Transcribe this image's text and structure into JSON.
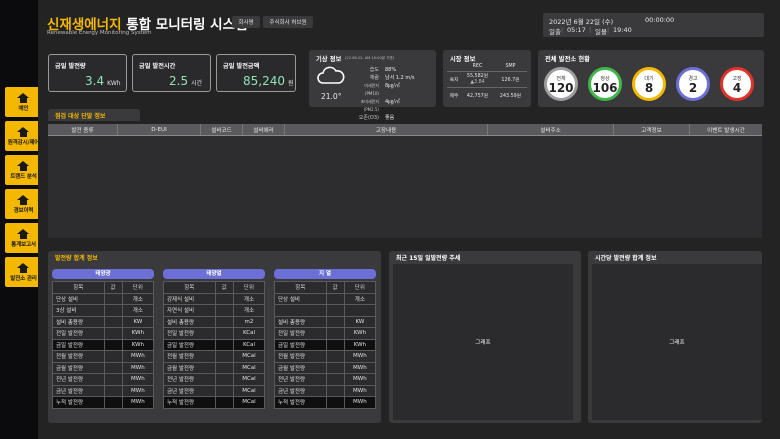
{
  "header": {
    "title_accent": "신재생에너지",
    "title_main": "통합 모니터링 시스템",
    "subtitle": "Renewable Energy Monitoring System",
    "btn_company": "회사명",
    "btn_company_name": "주식회사 허브원"
  },
  "datebar": {
    "date": "2022년 6월 22일 (수)",
    "time": "00:00:00",
    "sunrise_label": "일출",
    "sunrise": "05:17",
    "sunset_label": "일몰",
    "sunset": "19:40"
  },
  "sidebar": {
    "items": [
      "예인",
      "원격감시/제어",
      "트렌드 분석",
      "경보이력",
      "통계보고서",
      "발전소 관리"
    ]
  },
  "cards": [
    {
      "title": "금일 발전량",
      "value": "3.4",
      "unit": "KWh"
    },
    {
      "title": "금일 발전시간",
      "value": "2.5",
      "unit": "시간"
    },
    {
      "title": "금일 발전금액",
      "value": "85,240",
      "unit": "원"
    }
  ],
  "weather": {
    "title": "기상 정보",
    "updated": "(22.06.22. AM 10:00분 기준)",
    "temp": "21.0°",
    "rows": [
      {
        "label": "습도",
        "value": "88%"
      },
      {
        "label": "체람",
        "value": "남서 1.2 m/s"
      },
      {
        "label": "미세먼지(PM10)",
        "value": "8㎍/㎥"
      },
      {
        "label": "초미세먼지(PM2.5)",
        "value": "4㎍/㎥"
      },
      {
        "label": "오존(O3)",
        "value": "좋음"
      }
    ]
  },
  "market": {
    "title": "시장 정보",
    "col_rec": "REC",
    "col_smp": "SMP",
    "row1_label": "육지",
    "row1_rec": "55,582원",
    "row1_rec_change": "▲3.84",
    "row1_smp": "126.7원",
    "row2_label": "제주",
    "row2_rec": "42,757원",
    "row2_smp": "243.59원"
  },
  "plants": {
    "title": "전체 발전소 현황",
    "items": [
      {
        "label": "전체",
        "value": "120",
        "color": "#9e9e9e"
      },
      {
        "label": "정상",
        "value": "106",
        "color": "#3fb54a"
      },
      {
        "label": "대기",
        "value": "8",
        "color": "#f5b800"
      },
      {
        "label": "경고",
        "value": "2",
        "color": "#6b6fd6"
      },
      {
        "label": "고장",
        "value": "4",
        "color": "#e2332b"
      }
    ]
  },
  "inspect": {
    "title": "점검 대상 단말 정보",
    "columns": [
      "발전 종류",
      "D-EUI",
      "설비코드",
      "설비에러",
      "고장내용",
      "설비주소",
      "고객정보",
      "이벤트 발생시간"
    ]
  },
  "summary": {
    "title": "발전량 합계 정보",
    "col_item": "항목",
    "col_val": "값",
    "col_unit": "단위",
    "solar": {
      "title": "태양광",
      "rows": [
        {
          "item": "단상 설비",
          "unit": "개소"
        },
        {
          "item": "3상 설비",
          "unit": "개소"
        },
        {
          "item": "설비 총용량",
          "unit": "KW"
        },
        {
          "item": "전일 발전량",
          "unit": "KWh"
        },
        {
          "item": "금일 발전량",
          "unit": "KWh"
        },
        {
          "item": "전월 발전량",
          "unit": "MWh"
        },
        {
          "item": "금월 발전량",
          "unit": "MWh"
        },
        {
          "item": "전년 발전량",
          "unit": "MWh"
        },
        {
          "item": "금년 발전량",
          "unit": "MWh"
        },
        {
          "item": "누적 발전량",
          "unit": "MWh"
        }
      ]
    },
    "thermal": {
      "title": "태양열",
      "rows": [
        {
          "item": "강제식 설비",
          "unit": "개소"
        },
        {
          "item": "자연식 설비",
          "unit": "개소"
        },
        {
          "item": "설비 총용량",
          "unit": "m2"
        },
        {
          "item": "전일 발전량",
          "unit": "KCal"
        },
        {
          "item": "금일 발전량",
          "unit": "KCal"
        },
        {
          "item": "전월 발전량",
          "unit": "MCal"
        },
        {
          "item": "금월 발전량",
          "unit": "MCal"
        },
        {
          "item": "전년 발전량",
          "unit": "MCal"
        },
        {
          "item": "금년 발전량",
          "unit": "MCal"
        },
        {
          "item": "누적 발전량",
          "unit": "MCal"
        }
      ]
    },
    "geo": {
      "title": "지 열",
      "rows": [
        {
          "item": "항목",
          "unit": "단위"
        },
        {
          "item": "단상 설비",
          "unit": "개소"
        },
        {
          "item": "",
          "unit": ""
        },
        {
          "item": "설비 총용량",
          "unit": "KW"
        },
        {
          "item": "전일 발전량",
          "unit": "KWh"
        },
        {
          "item": "금일 발전량",
          "unit": "KWh"
        },
        {
          "item": "전월 발전량",
          "unit": "MWh"
        },
        {
          "item": "금월 발전량",
          "unit": "MWh"
        },
        {
          "item": "전년 발전량",
          "unit": "MWh"
        },
        {
          "item": "금년 발전량",
          "unit": "MWh"
        },
        {
          "item": "누적 발전량",
          "unit": "MWh"
        }
      ]
    }
  },
  "trend15": {
    "title": "최근 15일 일발전량 추세",
    "placeholder": "그래프"
  },
  "hourly": {
    "title": "시간당 발전량 합계 정보",
    "placeholder": "그래프"
  }
}
